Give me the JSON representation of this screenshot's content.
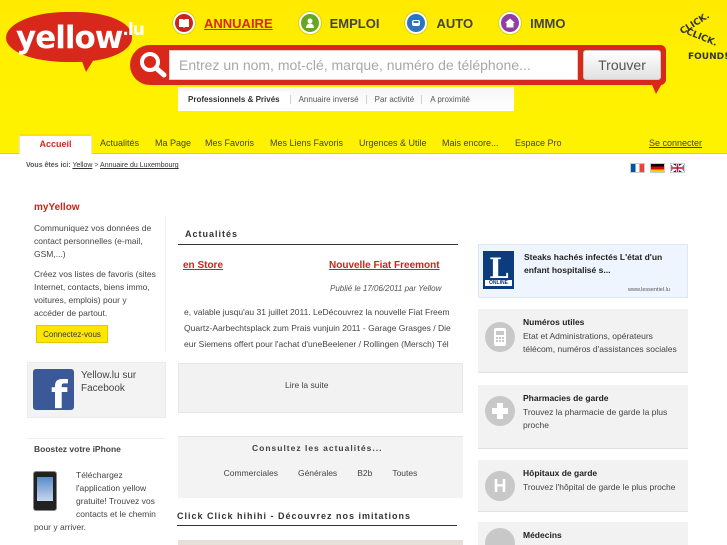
{
  "header": {
    "logo_text": "yellow",
    "logo_suffix": ".lu",
    "nav": [
      {
        "label": "ANNUAIRE",
        "icon": "book-icon",
        "color": "#c9261b",
        "active": true
      },
      {
        "label": "EMPLOI",
        "icon": "person-icon",
        "color": "#67a621",
        "active": false
      },
      {
        "label": "AUTO",
        "icon": "car-icon",
        "color": "#2a74c2",
        "active": false
      },
      {
        "label": "IMMO",
        "icon": "house-icon",
        "color": "#8e3fa2",
        "active": false
      }
    ],
    "tagline": {
      "line1": "CLICK.",
      "line2": "CLICK.",
      "line3": "FOUND!"
    }
  },
  "search": {
    "placeholder": "Entrez un nom, mot-clé, marque, numéro de téléphone...",
    "button_label": "Trouver",
    "tabs": [
      "Professionnels & Privés",
      "Annuaire inversé",
      "Par activité",
      "A proximité"
    ]
  },
  "main_nav": {
    "items": [
      "Accueil",
      "Actualités",
      "Ma Page",
      "Mes Favoris",
      "Mes Liens Favoris",
      "Urgences & Utile",
      "Mais encore...",
      "Espace Pro"
    ],
    "right_link": "Se connecter"
  },
  "breadcrumb": {
    "label": "Vous êtes ici:",
    "items": [
      "Yellow",
      "Annuaire du Luxembourg"
    ],
    "separator": ">"
  },
  "left": {
    "myyellow": {
      "title": "myYellow",
      "lines1": [
        "Communiquez vos données de",
        "contact personnelles (e-mail,",
        "GSM,...)"
      ],
      "lines2": [
        "Créez vos listes de favoris (sites",
        "Internet, contacts, biens immo,",
        "voitures, emplois) pour y",
        "accéder de partout."
      ],
      "button": "Connectez-vous"
    },
    "facebook": {
      "line1": "Yellow.lu sur",
      "line2": "Facebook"
    },
    "iphone": {
      "title": "Boostez votre iPhone",
      "lines": [
        "Téléchargez",
        "l'application yellow",
        "gratuite! Trouvez vos",
        "contacts et le chemin",
        "pour y arriver."
      ]
    }
  },
  "center": {
    "title": "Actualités",
    "news_link_1": "en Store",
    "news_link_2": "Nouvelle Fiat Freemont",
    "news_date": "Publié le 17/06/2011 par Yellow",
    "lines": [
      "e, valable jusqu'au 31 juillet 2011. LeDécouvrez la nouvelle Fiat Freem",
      "Quartz-Aarbechtsplack zum Prais vunjuin 2011 - Garage Grasges / Die",
      "eur Siemens offert pour l'achat d'uneBeelener / Rollingen (Mersch) Tél"
    ],
    "read_more": "Lire la suite",
    "consultez": "Consultez les actualités...",
    "categories": [
      "Commerciales",
      "Générales",
      "B2b",
      "Toutes"
    ],
    "click_title": "Click Click hihihi - Découvrez nos imitations"
  },
  "right": {
    "ad": {
      "text": "Steaks hachés infectés L'état d'un enfant hospitalisé s...",
      "logo_letter": "L",
      "logo_caption": "ONLINE",
      "source": "www.lessentiel.lu"
    },
    "services": [
      {
        "title": "Numéros utiles",
        "desc": "Etat et Administrations, opérateurs télécom, numéros d'assistances sociales",
        "icon": "phone-icon"
      },
      {
        "title": "Pharmacies de garde",
        "desc": "Trouvez la pharmacie de garde la plus proche",
        "icon": "cross-icon"
      },
      {
        "title": "Hôpitaux de garde",
        "desc": "Trouvez l'hôpital de garde le plus proche",
        "icon": "hospital-icon"
      },
      {
        "title": "Médecins",
        "desc": "",
        "icon": "doctor-icon"
      }
    ]
  },
  "colors": {
    "brand_yellow": "#fff200",
    "brand_red": "#d8281c",
    "link_red": "#c9261b"
  }
}
